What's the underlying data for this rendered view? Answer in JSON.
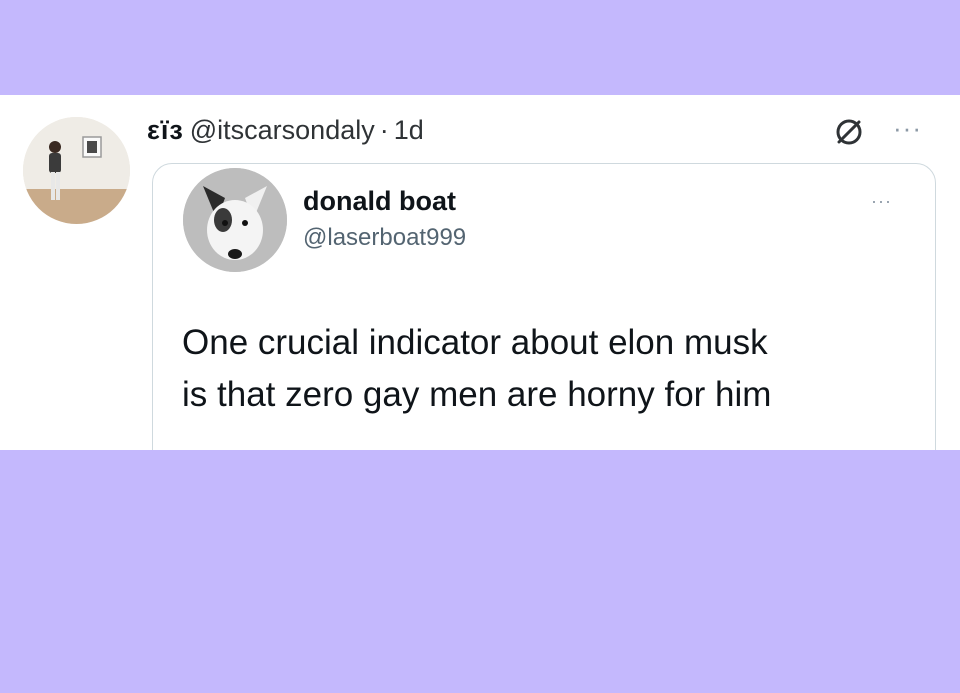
{
  "post": {
    "display_name": "εïз",
    "handle": "@itscarsondaly",
    "separator": "·",
    "time": "1d",
    "avatar_icon": "user-photo-avatar",
    "status_icon": "no-entry-icon",
    "more_icon": "more-options-icon",
    "more_glyph": "···"
  },
  "quote": {
    "name": "donald boat",
    "handle": "@laserboat999",
    "avatar_icon": "dog-photo-avatar",
    "more_glyph": "···",
    "text_lines": [
      "One crucial indicator about elon musk",
      "is that zero gay men are horny for him"
    ]
  },
  "colors": {
    "background": "#c4b8fd",
    "card": "#ffffff",
    "border": "#cfd9de"
  }
}
